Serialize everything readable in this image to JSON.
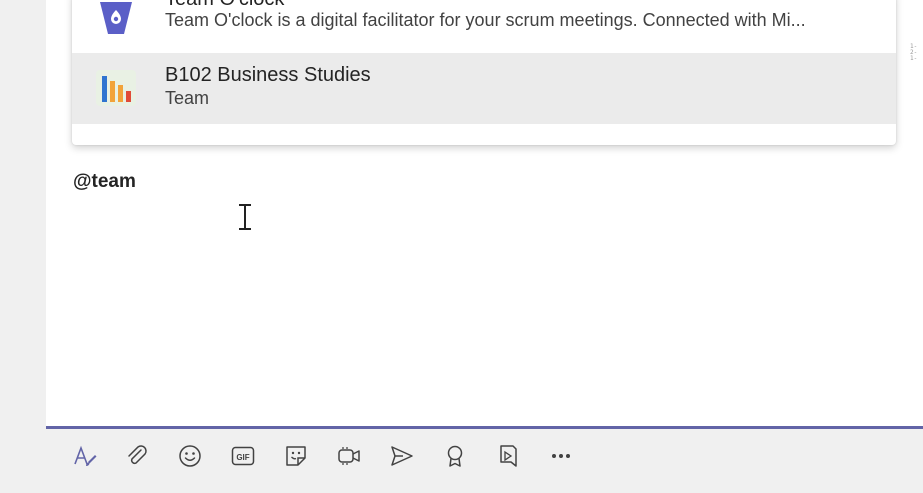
{
  "suggestions": [
    {
      "title": "Team O'clock",
      "subtitle": "Team O'clock is a digital facilitator for your scrum meetings. Connected with Mi...",
      "icon": "team-oclock-app-icon"
    },
    {
      "title": "B102 Business Studies",
      "subtitle": "Team",
      "icon": "team-chart-icon"
    }
  ],
  "compose": {
    "mention": "@team"
  },
  "side_marks": "1-\n2-\n1-",
  "toolbar": {
    "items": [
      {
        "name": "format-icon"
      },
      {
        "name": "attach-icon"
      },
      {
        "name": "emoji-icon"
      },
      {
        "name": "gif-icon",
        "label": "GIF"
      },
      {
        "name": "sticker-icon"
      },
      {
        "name": "meet-now-icon"
      },
      {
        "name": "schedule-send-icon"
      },
      {
        "name": "praise-icon"
      },
      {
        "name": "stream-icon"
      },
      {
        "name": "more-options-icon",
        "label": "..."
      }
    ]
  },
  "colors": {
    "accent": "#6264a7",
    "app_icon_purple": "#5b5fc7",
    "bar_blue": "#2f74d0",
    "bar_orange": "#f2a33a",
    "bar_red": "#e14b38"
  }
}
